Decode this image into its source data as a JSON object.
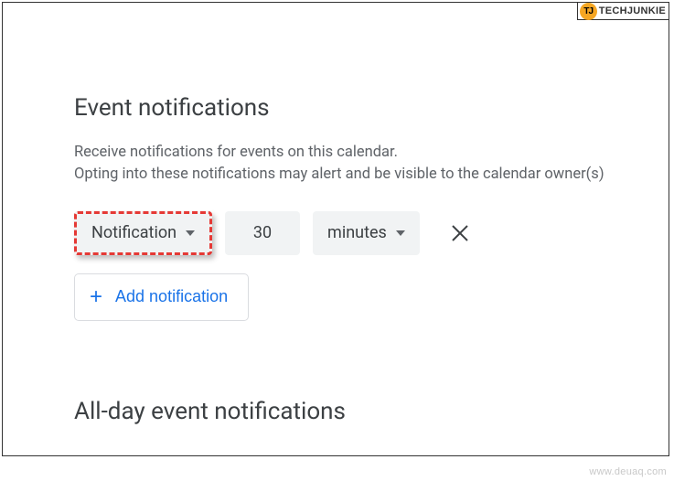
{
  "badge": {
    "text": "TECHJUNKIE"
  },
  "section1": {
    "title": "Event notifications",
    "description_line1": "Receive notifications for events on this calendar.",
    "description_line2": "Opting into these notifications may alert and be visible to the calendar owner(s)",
    "type_select": "Notification",
    "value": "30",
    "unit_select": "minutes",
    "add_button": "Add notification"
  },
  "section2": {
    "title": "All-day event notifications"
  },
  "watermark": "www.deuaq.com"
}
